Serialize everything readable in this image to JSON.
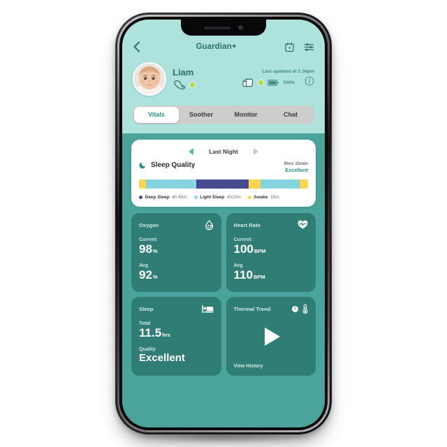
{
  "header": {
    "title": "Guardian+",
    "back_icon": "chevron-left-icon",
    "calendar_icon": "calendar-icon",
    "settings_icon": "sliders-icon"
  },
  "baby": {
    "name": "Liam",
    "device_icon": "sock-sensor-icon",
    "device_status": "online",
    "last_updated": "Last updated at 1:36pm",
    "base_icon": "base-station-icon",
    "base_status": "online",
    "battery_icon": "battery-icon",
    "battery_level": "100%",
    "info_icon": "info-icon"
  },
  "tabs": [
    {
      "label": "Vitals",
      "active": true
    },
    {
      "label": "Soother",
      "active": false
    },
    {
      "label": "Monitor",
      "active": false
    },
    {
      "label": "Chat",
      "active": false
    }
  ],
  "sleep_card": {
    "prev_icon": "caret-left-icon",
    "period": "Last Night",
    "next_icon": "caret-right-icon",
    "moon_icon": "moon-icon",
    "title": "Sleep Quality",
    "duration": "9hrs 15min",
    "quality": "Excellent",
    "legend": [
      {
        "name": "Deep Sleep",
        "value": "4h 45m",
        "color": "#474a8f"
      },
      {
        "name": "Light Sleep",
        "value": "4h20m",
        "color": "#86d3e0"
      },
      {
        "name": "Awake",
        "value": "15m",
        "color": "#fbd450"
      }
    ],
    "segments": [
      {
        "type": "Awake",
        "color": "#fbd450",
        "pct": 4
      },
      {
        "type": "Light Sleep",
        "color": "#86d3e0",
        "pct": 28
      },
      {
        "type": "Light Sleep",
        "color": "#8ed6e2",
        "pct": 2
      },
      {
        "type": "Deep Sleep",
        "color": "#474a8f",
        "pct": 31
      },
      {
        "type": "Awake",
        "color": "#fbd450",
        "pct": 7
      },
      {
        "type": "Light Sleep",
        "color": "#86d3e0",
        "pct": 23
      },
      {
        "type": "Awake",
        "color": "#fbd450",
        "pct": 5
      }
    ]
  },
  "metrics": {
    "oxygen": {
      "title": "Oxygen",
      "icon": "oxygen-drop-icon",
      "current_label": "Current",
      "current_value": "98",
      "current_unit": "%",
      "avg_label": "Avg",
      "avg_value": "92",
      "avg_unit": "%"
    },
    "heart_rate": {
      "title": "Heart Rate",
      "icon": "heart-pulse-icon",
      "current_label": "Current",
      "current_value": "100",
      "current_unit": "BPM",
      "avg_label": "Avg",
      "avg_value": "110",
      "avg_unit": "BPM"
    },
    "sleep": {
      "title": "Sleep",
      "icon": "bed-icon",
      "total_label": "Total",
      "total_value": "11.5",
      "total_unit": "hrs",
      "quality_label": "Quality",
      "quality_value": "Excellent"
    },
    "thermal": {
      "title": "Thermal Trend",
      "badge": "i",
      "icon": "thermometer-icon",
      "play_icon": "play-icon",
      "view_history": "View History"
    }
  },
  "colors": {
    "header_mint": "#aee2dd",
    "body_teal": "#4ba49c",
    "card_teal": "#2f7d75",
    "accent_teal": "#2f8f86",
    "status_green": "#b9d943"
  }
}
